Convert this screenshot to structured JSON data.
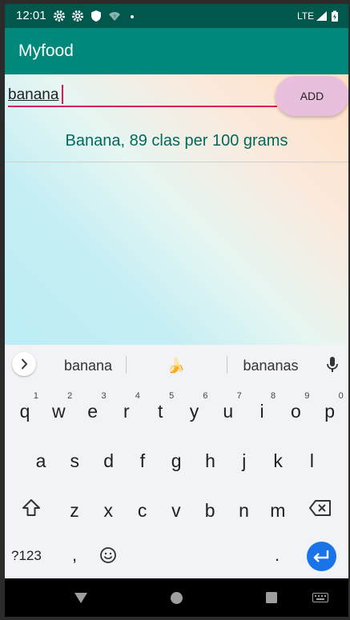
{
  "status_bar": {
    "time": "12:01",
    "network_label": "LTE",
    "icons": [
      "gear-icon",
      "gear-icon",
      "shield-icon",
      "wifi-icon",
      "dot-icon",
      "signal-icon",
      "battery-icon"
    ]
  },
  "app_bar": {
    "title": "Myfood"
  },
  "form": {
    "input_value": "banana",
    "add_label": "ADD"
  },
  "result": {
    "text": "Banana, 89 clas per 100 grams"
  },
  "keyboard": {
    "suggestions": [
      "banana",
      "🍌",
      "bananas"
    ],
    "row1": [
      {
        "ch": "q",
        "hint": "1"
      },
      {
        "ch": "w",
        "hint": "2"
      },
      {
        "ch": "e",
        "hint": "3"
      },
      {
        "ch": "r",
        "hint": "4"
      },
      {
        "ch": "t",
        "hint": "5"
      },
      {
        "ch": "y",
        "hint": "6"
      },
      {
        "ch": "u",
        "hint": "7"
      },
      {
        "ch": "i",
        "hint": "8"
      },
      {
        "ch": "o",
        "hint": "9"
      },
      {
        "ch": "p",
        "hint": "0"
      }
    ],
    "row2": [
      "a",
      "s",
      "d",
      "f",
      "g",
      "h",
      "j",
      "k",
      "l"
    ],
    "row3": [
      "z",
      "x",
      "c",
      "v",
      "b",
      "n",
      "m"
    ],
    "symbols_label": "?123",
    "comma_label": ",",
    "period_label": "."
  },
  "colors": {
    "status_bar": "#00574b",
    "app_bar": "#00897b",
    "accent": "#d81b60",
    "result_text": "#00695c",
    "add_button": "#e8bfdc",
    "enter_key": "#1a73e8"
  }
}
